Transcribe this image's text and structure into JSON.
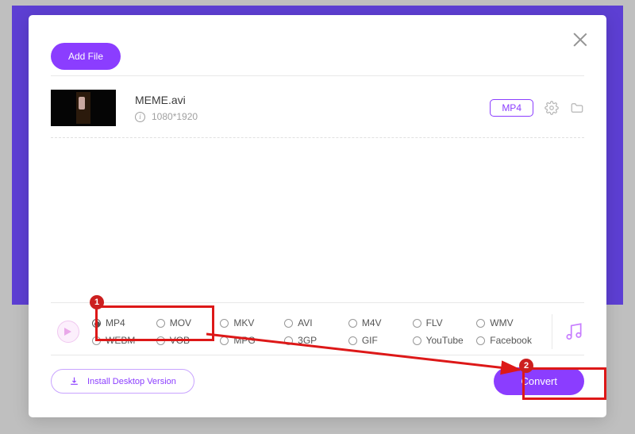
{
  "header": {
    "add_file_label": "Add File"
  },
  "file": {
    "name": "MEME.avi",
    "resolution": "1080*1920",
    "format_tag": "MP4"
  },
  "formats": {
    "row1": [
      "MP4",
      "MOV",
      "MKV",
      "AVI",
      "M4V",
      "FLV",
      "WMV"
    ],
    "row2": [
      "WEBM",
      "VOB",
      "MPG",
      "3GP",
      "GIF",
      "YouTube",
      "Facebook"
    ],
    "selected": "MP4"
  },
  "footer": {
    "install_label": "Install Desktop Version",
    "convert_label": "Convert"
  },
  "annotations": {
    "badge1": "1",
    "badge2": "2"
  }
}
